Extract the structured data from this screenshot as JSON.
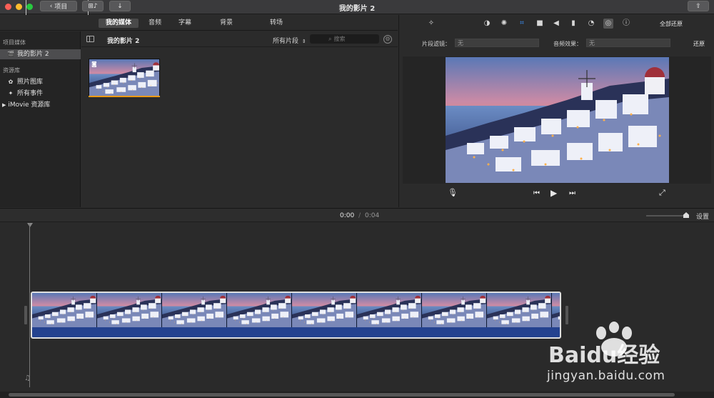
{
  "window": {
    "title": "我的影片 2"
  },
  "toolbar": {
    "back_label": "项目"
  },
  "library_tabs": [
    "我的媒体",
    "音频",
    "字幕",
    "背景",
    "转场"
  ],
  "sidebar": {
    "project_media_heading": "项目媒体",
    "project_item": "我的影片 2",
    "libraries_heading": "资源库",
    "items": [
      "照片图库",
      "所有事件",
      "iMovie 资源库"
    ]
  },
  "browser": {
    "title": "我的影片 2",
    "filter": "所有片段",
    "search_placeholder": "搜索"
  },
  "inspector": {
    "reset_all": "全部还原",
    "clip_filter_label": "片段滤镜：",
    "clip_filter_value": "无",
    "audio_effect_label": "音频效果：",
    "audio_effect_value": "无",
    "reset": "还原"
  },
  "timeline": {
    "current_time": "0:00",
    "separator": "/",
    "total_time": "0:04",
    "settings_label": "设置",
    "zoom": 0.9
  },
  "watermark": {
    "brand": "Baidu经验",
    "url": "jingyan.baidu.com"
  },
  "colors": {
    "accent": "#f09a14",
    "clip_blue": "#24428f",
    "close": "#fc5f57",
    "minimize": "#fdbc2e",
    "zoom": "#28c840"
  }
}
